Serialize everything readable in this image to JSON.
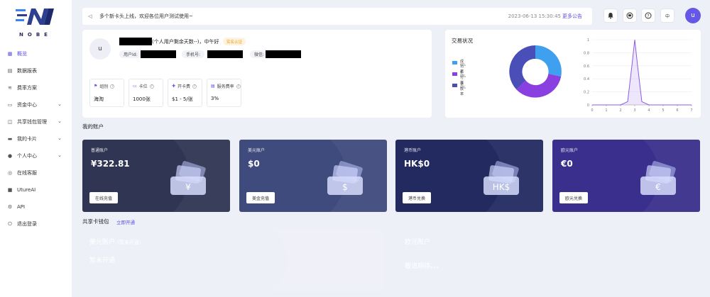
{
  "logo": {
    "text": "NOBE"
  },
  "sidebar": {
    "items": [
      {
        "label": "概览",
        "icon": "dashboard-icon",
        "active": true,
        "expandable": false
      },
      {
        "label": "数据报表",
        "icon": "report-icon",
        "active": false,
        "expandable": false
      },
      {
        "label": "费率方案",
        "icon": "rate-icon",
        "active": false,
        "expandable": false
      },
      {
        "label": "资金中心",
        "icon": "wallet-icon",
        "active": false,
        "expandable": true
      },
      {
        "label": "共享钱包管理",
        "icon": "share-wallet-icon",
        "active": false,
        "expandable": true
      },
      {
        "label": "我的卡片",
        "icon": "card-icon",
        "active": false,
        "expandable": true
      },
      {
        "label": "个人中心",
        "icon": "user-icon",
        "active": false,
        "expandable": true
      },
      {
        "label": "在线客服",
        "icon": "support-icon",
        "active": false,
        "expandable": false
      },
      {
        "label": "UtureAI",
        "icon": "ai-icon",
        "active": false,
        "expandable": false
      },
      {
        "label": "API",
        "icon": "api-icon",
        "active": false,
        "expandable": false
      },
      {
        "label": "退出登录",
        "icon": "logout-icon",
        "active": false,
        "expandable": false
      }
    ]
  },
  "notice": {
    "message": "多个新卡头上线，欢迎各位用户测试使用~",
    "time": "2023-06-13 15:30:45",
    "more": "更多公告"
  },
  "header": {
    "avatar": "u",
    "icons": [
      "bell-icon",
      "message-icon",
      "help-icon",
      "language-icon"
    ],
    "lang_glyph": "中"
  },
  "profile": {
    "avatar": "u",
    "greeting": "(个人用户剩余天数--)，中午好",
    "badge": "实名认证",
    "user_id_label": "用户Id:",
    "phone_label": "手机号:",
    "wechat_label": "微信:",
    "stats": [
      {
        "label": "组别",
        "value": "海淘",
        "icon": "flag-icon"
      },
      {
        "label": "卡位",
        "value": "1000张",
        "icon": "card-slot-icon"
      },
      {
        "label": "开卡费",
        "value": "$1 - 5/张",
        "icon": "fee-icon"
      },
      {
        "label": "服务费率",
        "value": "3%",
        "icon": "percent-icon"
      }
    ]
  },
  "trade": {
    "title": "交易状况",
    "legend": [
      {
        "name": "成功率",
        "value": "0%",
        "color": "#3fa0f0"
      },
      {
        "name": "拒付率",
        "value": "0%",
        "color": "#8a3fe0"
      },
      {
        "name": "退款率",
        "value": "0%",
        "color": "#4a4fb8"
      }
    ]
  },
  "chart_data": {
    "type": "line",
    "x": [
      0,
      1,
      2,
      2.5,
      2.8,
      3,
      3.2,
      3.5,
      4,
      5,
      6,
      7
    ],
    "series": [
      {
        "values": [
          0,
          0,
          0,
          0.05,
          0.6,
          1,
          0.6,
          0.05,
          0,
          0,
          0,
          0
        ]
      }
    ],
    "xlim": [
      0,
      7
    ],
    "ylim": [
      0,
      1
    ],
    "xticks": [
      "0",
      "1",
      "2",
      "3",
      "4",
      "5",
      "6",
      "7"
    ],
    "yticks": [
      "0",
      "0.2",
      "0.4",
      "0.6",
      "0.8",
      "1"
    ],
    "grid": true,
    "color": "#8a5ce6"
  },
  "my_accounts": {
    "title": "我的账户",
    "cards": [
      {
        "name": "普通账户",
        "value": "¥322.81",
        "button": "在线充值",
        "symbol": "¥",
        "bg": "#2f3553"
      },
      {
        "name": "美元账户",
        "value": "$0",
        "button": "美金充值",
        "symbol": "$",
        "bg": "#3f4a7d"
      },
      {
        "name": "港币账户",
        "value": "HK$0",
        "button": "港币兑换",
        "symbol": "HK$",
        "bg": "#222a5f"
      },
      {
        "name": "欧元账户",
        "value": "€0",
        "button": "欧元兑换",
        "symbol": "€",
        "bg": "#3a2f8c"
      }
    ]
  },
  "shared_wallet": {
    "title": "共享卡钱包",
    "link": "立即开通",
    "cards": [
      {
        "title": "美元账户",
        "subtitle": "(暂未开通)",
        "status": "暂未开通",
        "bg": "#6a56e8"
      },
      {
        "title": "欧元账户",
        "subtitle": "",
        "status": "敬请期待。。。",
        "bg": "#242b55"
      }
    ]
  }
}
